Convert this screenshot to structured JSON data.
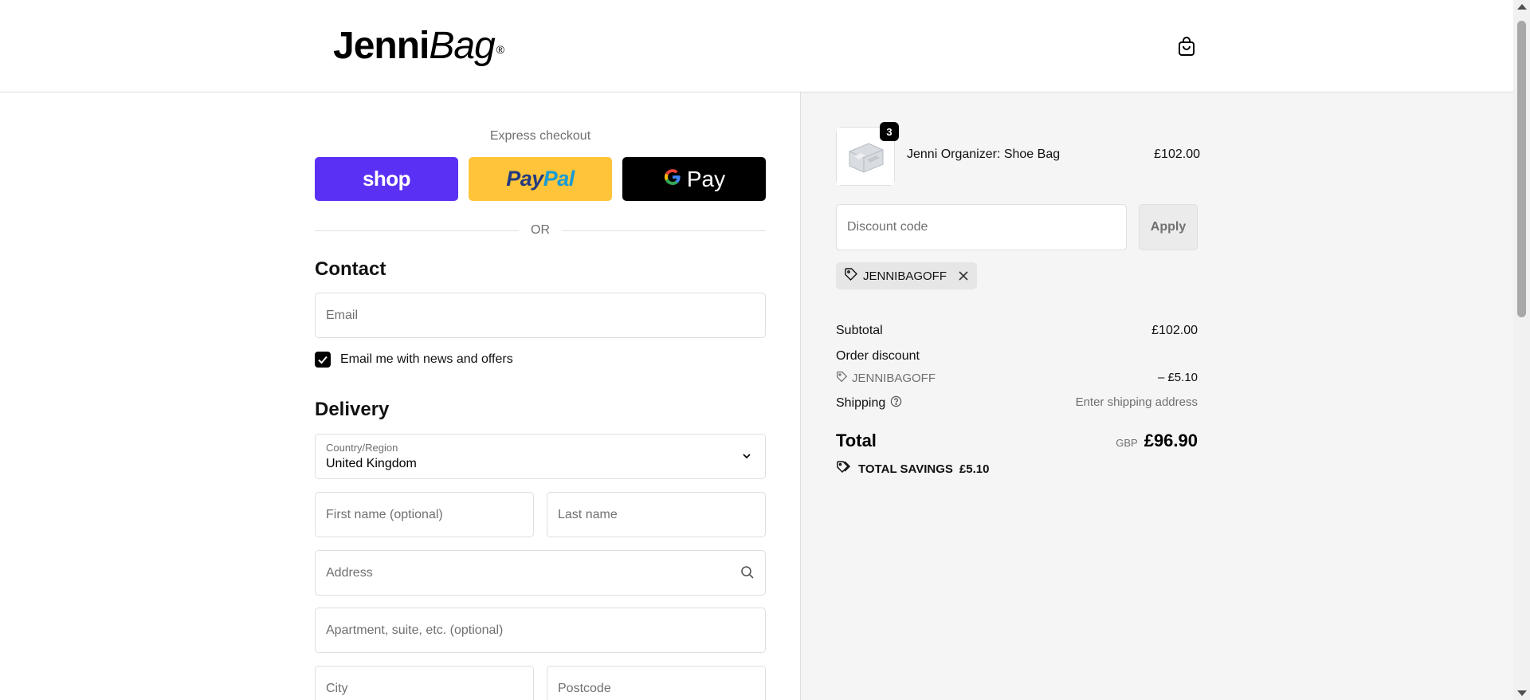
{
  "brand": {
    "name_bold": "Jenni",
    "name_italic": "Bag",
    "mark": "®"
  },
  "header": {
    "cart_icon": "shopping-bag-icon"
  },
  "express": {
    "label": "Express checkout",
    "shop_label": "shop",
    "paypal_label_a": "Pay",
    "paypal_label_b": "Pal",
    "gpay_label": "Pay",
    "or_text": "OR"
  },
  "contact": {
    "title": "Contact",
    "email_placeholder": "Email",
    "newsletter_label": "Email me with news and offers",
    "newsletter_checked": true
  },
  "delivery": {
    "title": "Delivery",
    "country_label": "Country/Region",
    "country_value": "United Kingdom",
    "first_name_placeholder": "First name (optional)",
    "last_name_placeholder": "Last name",
    "address_placeholder": "Address",
    "apartment_placeholder": "Apartment, suite, etc. (optional)",
    "city_placeholder": "City",
    "postcode_placeholder": "Postcode"
  },
  "order": {
    "item": {
      "name": "Jenni Organizer: Shoe Bag",
      "price": "£102.00",
      "quantity": "3"
    },
    "discount_placeholder": "Discount code",
    "apply_label": "Apply",
    "applied_code": "JENNIBAGOFF",
    "subtotal_label": "Subtotal",
    "subtotal_value": "£102.00",
    "order_discount_label": "Order discount",
    "discount_code_label": "JENNIBAGOFF",
    "discount_value": "– £5.10",
    "shipping_label": "Shipping",
    "shipping_value": "Enter shipping address",
    "total_label": "Total",
    "currency": "GBP",
    "total_value": "£96.90",
    "savings_label": "TOTAL SAVINGS",
    "savings_value": "£5.10"
  },
  "colors": {
    "shop": "#5a31f4",
    "paypal": "#ffc439",
    "gpay": "#000000",
    "sidebar_bg": "#f5f5f5"
  }
}
